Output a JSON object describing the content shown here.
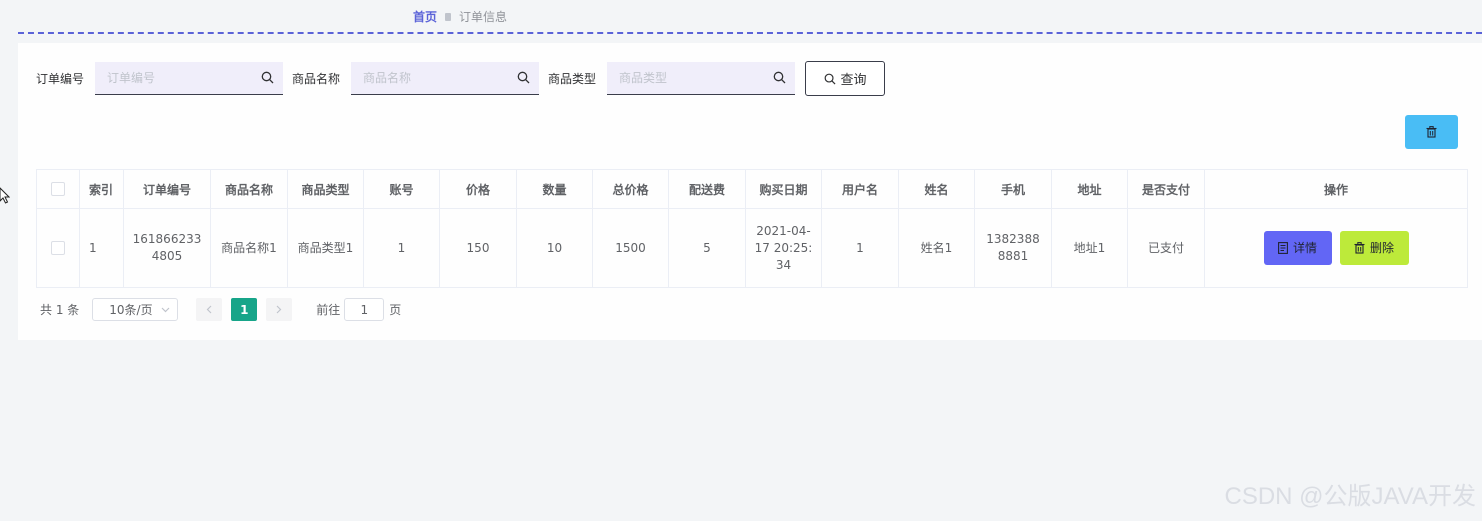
{
  "breadcrumb": {
    "home": "首页",
    "current": "订单信息"
  },
  "search": {
    "order_no_label": "订单编号",
    "order_no_placeholder": "订单编号",
    "product_name_label": "商品名称",
    "product_name_placeholder": "商品名称",
    "product_type_label": "商品类型",
    "product_type_placeholder": "商品类型",
    "query_label": "查询"
  },
  "table": {
    "headers": {
      "index": "索引",
      "order_no": "订单编号",
      "product_name": "商品名称",
      "product_type": "商品类型",
      "account": "账号",
      "price": "价格",
      "quantity": "数量",
      "total_price": "总价格",
      "delivery_fee": "配送费",
      "purchase_date": "购买日期",
      "username": "用户名",
      "name": "姓名",
      "phone": "手机",
      "address": "地址",
      "paid": "是否支付",
      "actions": "操作"
    },
    "rows": [
      {
        "index": "1",
        "order_no": "1618662334805",
        "product_name": "商品名称1",
        "product_type": "商品类型1",
        "account": "1",
        "price": "150",
        "quantity": "10",
        "total_price": "1500",
        "delivery_fee": "5",
        "purchase_date": "2021-04-17 20:25:34",
        "username": "1",
        "name": "姓名1",
        "phone": "13823888881",
        "address": "地址1",
        "paid": "已支付",
        "detail_label": "详情",
        "delete_label": "删除"
      }
    ]
  },
  "pagination": {
    "total_text": "共 1 条",
    "page_size": "10条/页",
    "current_page": "1",
    "goto_prefix": "前往",
    "goto_value": "1",
    "goto_suffix": "页"
  },
  "watermark": "CSDN @公版JAVA开发",
  "colors": {
    "accent": "#5b63d8",
    "detail_button": "#6266f5",
    "delete_button": "#bdea3a",
    "bulk_delete_button": "#49bdf5",
    "active_page": "#17a589"
  }
}
